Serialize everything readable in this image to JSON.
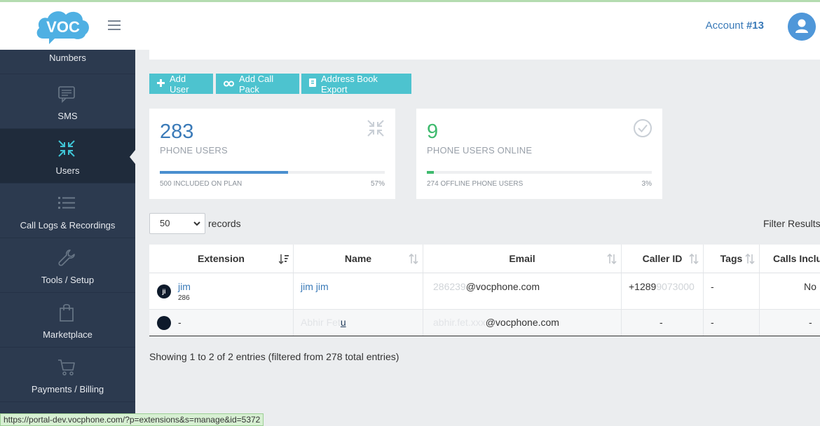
{
  "app": {
    "logo_text": "VOC",
    "brand_color": "#4f97d9",
    "sidebar_bg": "#2c3a4f"
  },
  "topbar": {
    "account_label": "Account",
    "account_number": "#13"
  },
  "sidebar": {
    "items": [
      {
        "label": "Numbers",
        "icon": "numbers-icon"
      },
      {
        "label": "SMS",
        "icon": "chat-icon"
      },
      {
        "label": "Users",
        "icon": "compress-arrows-icon",
        "active": true
      },
      {
        "label": "Call Logs & Recordings",
        "icon": "list-icon"
      },
      {
        "label": "Tools / Setup",
        "icon": "wrench-icon"
      },
      {
        "label": "Marketplace",
        "icon": "shopping-bag-icon"
      },
      {
        "label": "Payments / Billing",
        "icon": "cart-icon"
      }
    ]
  },
  "actions": {
    "add_user": "Add User",
    "add_call_pack": "Add Call Pack",
    "address_book_export": "Address Book Export"
  },
  "stats": {
    "phone_users": {
      "value": "283",
      "title": "PHONE USERS",
      "foot_left": "500 INCLUDED ON PLAN",
      "foot_right": "57%",
      "progress": 0.57
    },
    "online": {
      "value": "9",
      "title": "PHONE USERS ONLINE",
      "foot_left": "274 OFFLINE PHONE USERS",
      "foot_right": "3%",
      "progress": 0.03
    }
  },
  "records": {
    "selected": "50",
    "label": "records",
    "filter_label": "Filter Results"
  },
  "table": {
    "columns": [
      "Extension",
      "Name",
      "Email",
      "Caller ID",
      "Tags",
      "Calls Inclu"
    ],
    "rows": [
      {
        "initials": "ji",
        "extension": "jim",
        "ext_number": "286",
        "name": "jim jim",
        "email": "@vocphone.com",
        "email_prefix": "286239",
        "caller_id": "+1289",
        "tags": "-",
        "calls": "No"
      },
      {
        "initials": "",
        "extension": "-",
        "ext_number": "",
        "name": "u",
        "email": "@vocphone.com",
        "email_prefix": "",
        "caller_id": "-",
        "tags": "-",
        "calls": "-"
      }
    ]
  },
  "footer": {
    "showing": "Showing 1 to 2 of 2 entries (filtered from 278 total entries)"
  },
  "status_url": "https://portal-dev.vocphone.com/?p=extensions&s=manage&id=5372"
}
